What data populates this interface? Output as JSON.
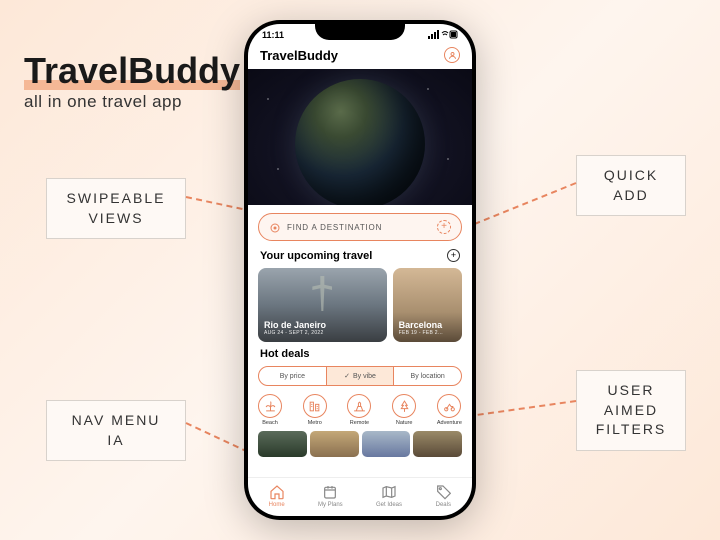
{
  "brand": {
    "title": "TravelBuddy",
    "sub": "all in one travel app"
  },
  "callouts": {
    "swipe": "SWIPEABLE VIEWS",
    "quick": "QUICK ADD",
    "nav": "NAV MENU IA",
    "filters": "USER AIMED FILTERS"
  },
  "status": {
    "time": "11:11",
    "right": "􀙇 􀛨"
  },
  "app": {
    "name": "TravelBuddy"
  },
  "search": {
    "placeholder": "FIND A DESTINATION"
  },
  "upcoming": {
    "title": "Your upcoming travel",
    "cards": [
      {
        "name": "Rio de Janeiro",
        "date": "AUG 24 - SEPT 2, 2022"
      },
      {
        "name": "Barcelona",
        "date": "FEB 19 - FEB 2…"
      }
    ]
  },
  "hotdeals": {
    "title": "Hot deals",
    "filters": [
      "By price",
      "By vibe",
      "By location"
    ],
    "active": 1,
    "cats": [
      "Beach",
      "Metro",
      "Remote",
      "Nature",
      "Adventure"
    ]
  },
  "tabs": [
    "Home",
    "My Plans",
    "Get Ideas",
    "Deals"
  ],
  "colors": {
    "accent": "#e8855f"
  }
}
